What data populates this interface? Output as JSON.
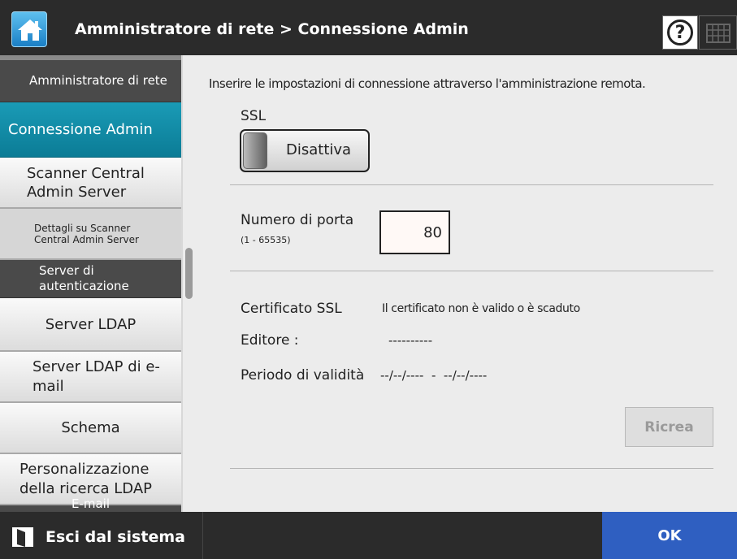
{
  "header": {
    "title": "Amministratore di rete > Connessione Admin",
    "home_icon": "home-icon",
    "help_icon": "help-icon",
    "help_glyph": "?",
    "keyboard_icon": "keyboard-icon"
  },
  "sidebar": {
    "items": [
      {
        "label": "Amministratore di rete",
        "state": "header"
      },
      {
        "label": "Connessione Admin",
        "state": "selected"
      },
      {
        "label": "Scanner Central Admin Server",
        "state": "normal"
      },
      {
        "label": "Dettagli su Scanner Central Admin Server",
        "state": "sub"
      },
      {
        "label": "Server di autenticazione",
        "state": "header"
      },
      {
        "label": "Server LDAP",
        "state": "normal"
      },
      {
        "label": "Server LDAP di e-mail",
        "state": "normal"
      },
      {
        "label": "Schema",
        "state": "normal"
      },
      {
        "label": "Personalizzazione della ricerca LDAP",
        "state": "normal"
      },
      {
        "label": "E-mail",
        "state": "header"
      }
    ]
  },
  "main": {
    "intro": "Inserire le impostazioni di connessione attraverso l'amministrazione remota.",
    "ssl": {
      "label": "SSL",
      "toggle_text": "Disattiva"
    },
    "port": {
      "label": "Numero di porta",
      "range": "(1 - 65535)",
      "value": "80"
    },
    "certificate": {
      "label": "Certificato SSL",
      "status": "Il certificato non è valido o è scaduto",
      "publisher_label": "Editore  :",
      "publisher_value": "----------",
      "validity_label": "Periodo di validità",
      "validity_value": "--/--/----  -  --/--/----",
      "recreate_label": "Ricrea"
    }
  },
  "footer": {
    "logout_label": "Esci dal sistema",
    "logout_icon": "logout-icon",
    "ok_label": "OK"
  },
  "colors": {
    "selected_item": "#0b7c96",
    "ok_button": "#2f5fc1",
    "header_bg": "#2b2b2b"
  }
}
